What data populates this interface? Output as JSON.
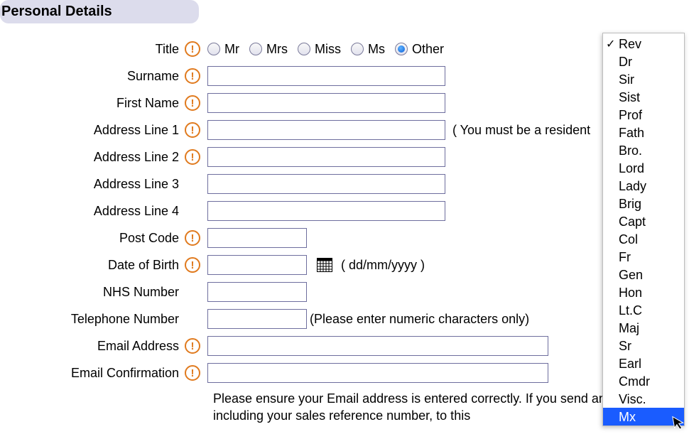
{
  "section_title": "Personal Details",
  "title_row": {
    "label": "Title",
    "options": [
      "Mr",
      "Mrs",
      "Miss",
      "Ms",
      "Other"
    ],
    "selected": "Other"
  },
  "fields": {
    "surname": {
      "label": "Surname",
      "required": true,
      "width": "w-med",
      "value": ""
    },
    "first_name": {
      "label": "First Name",
      "required": true,
      "width": "w-med",
      "value": ""
    },
    "addr1": {
      "label": "Address Line 1",
      "required": true,
      "width": "w-med",
      "value": "",
      "hint": "( You must be a resident"
    },
    "addr2": {
      "label": "Address Line 2",
      "required": true,
      "width": "w-med",
      "value": ""
    },
    "addr3": {
      "label": "Address Line 3",
      "required": false,
      "width": "w-med",
      "value": ""
    },
    "addr4": {
      "label": "Address Line 4",
      "required": false,
      "width": "w-med",
      "value": ""
    },
    "postcode": {
      "label": "Post Code",
      "required": true,
      "width": "w-sm",
      "value": ""
    },
    "dob": {
      "label": "Date of Birth",
      "required": true,
      "width": "w-sm",
      "value": "",
      "hint": "( dd/mm/yyyy )",
      "calendar": true
    },
    "nhs": {
      "label": "NHS Number",
      "required": false,
      "width": "w-sm",
      "value": ""
    },
    "tel": {
      "label": "Telephone Number",
      "required": false,
      "width": "w-sm",
      "value": "",
      "hint": "(Please enter numeric characters only)"
    },
    "email": {
      "label": "Email Address",
      "required": true,
      "width": "w-lg",
      "value": ""
    },
    "email2": {
      "label": "Email Confirmation",
      "required": true,
      "width": "w-lg",
      "value": ""
    }
  },
  "note": "Please ensure your Email address is entered correctly. If you send an Email, including your sales reference number, to this",
  "dropdown": {
    "checked": "Rev",
    "highlighted": "Mx",
    "options": [
      "Rev",
      "Dr",
      "Sir",
      "Sist",
      "Prof",
      "Fath",
      "Bro.",
      "Lord",
      "Lady",
      "Brig",
      "Capt",
      "Col",
      "Fr",
      "Gen",
      "Hon",
      "Lt.C",
      "Maj",
      "Sr",
      "Earl",
      "Cmdr",
      "Visc.",
      "Mx"
    ]
  }
}
